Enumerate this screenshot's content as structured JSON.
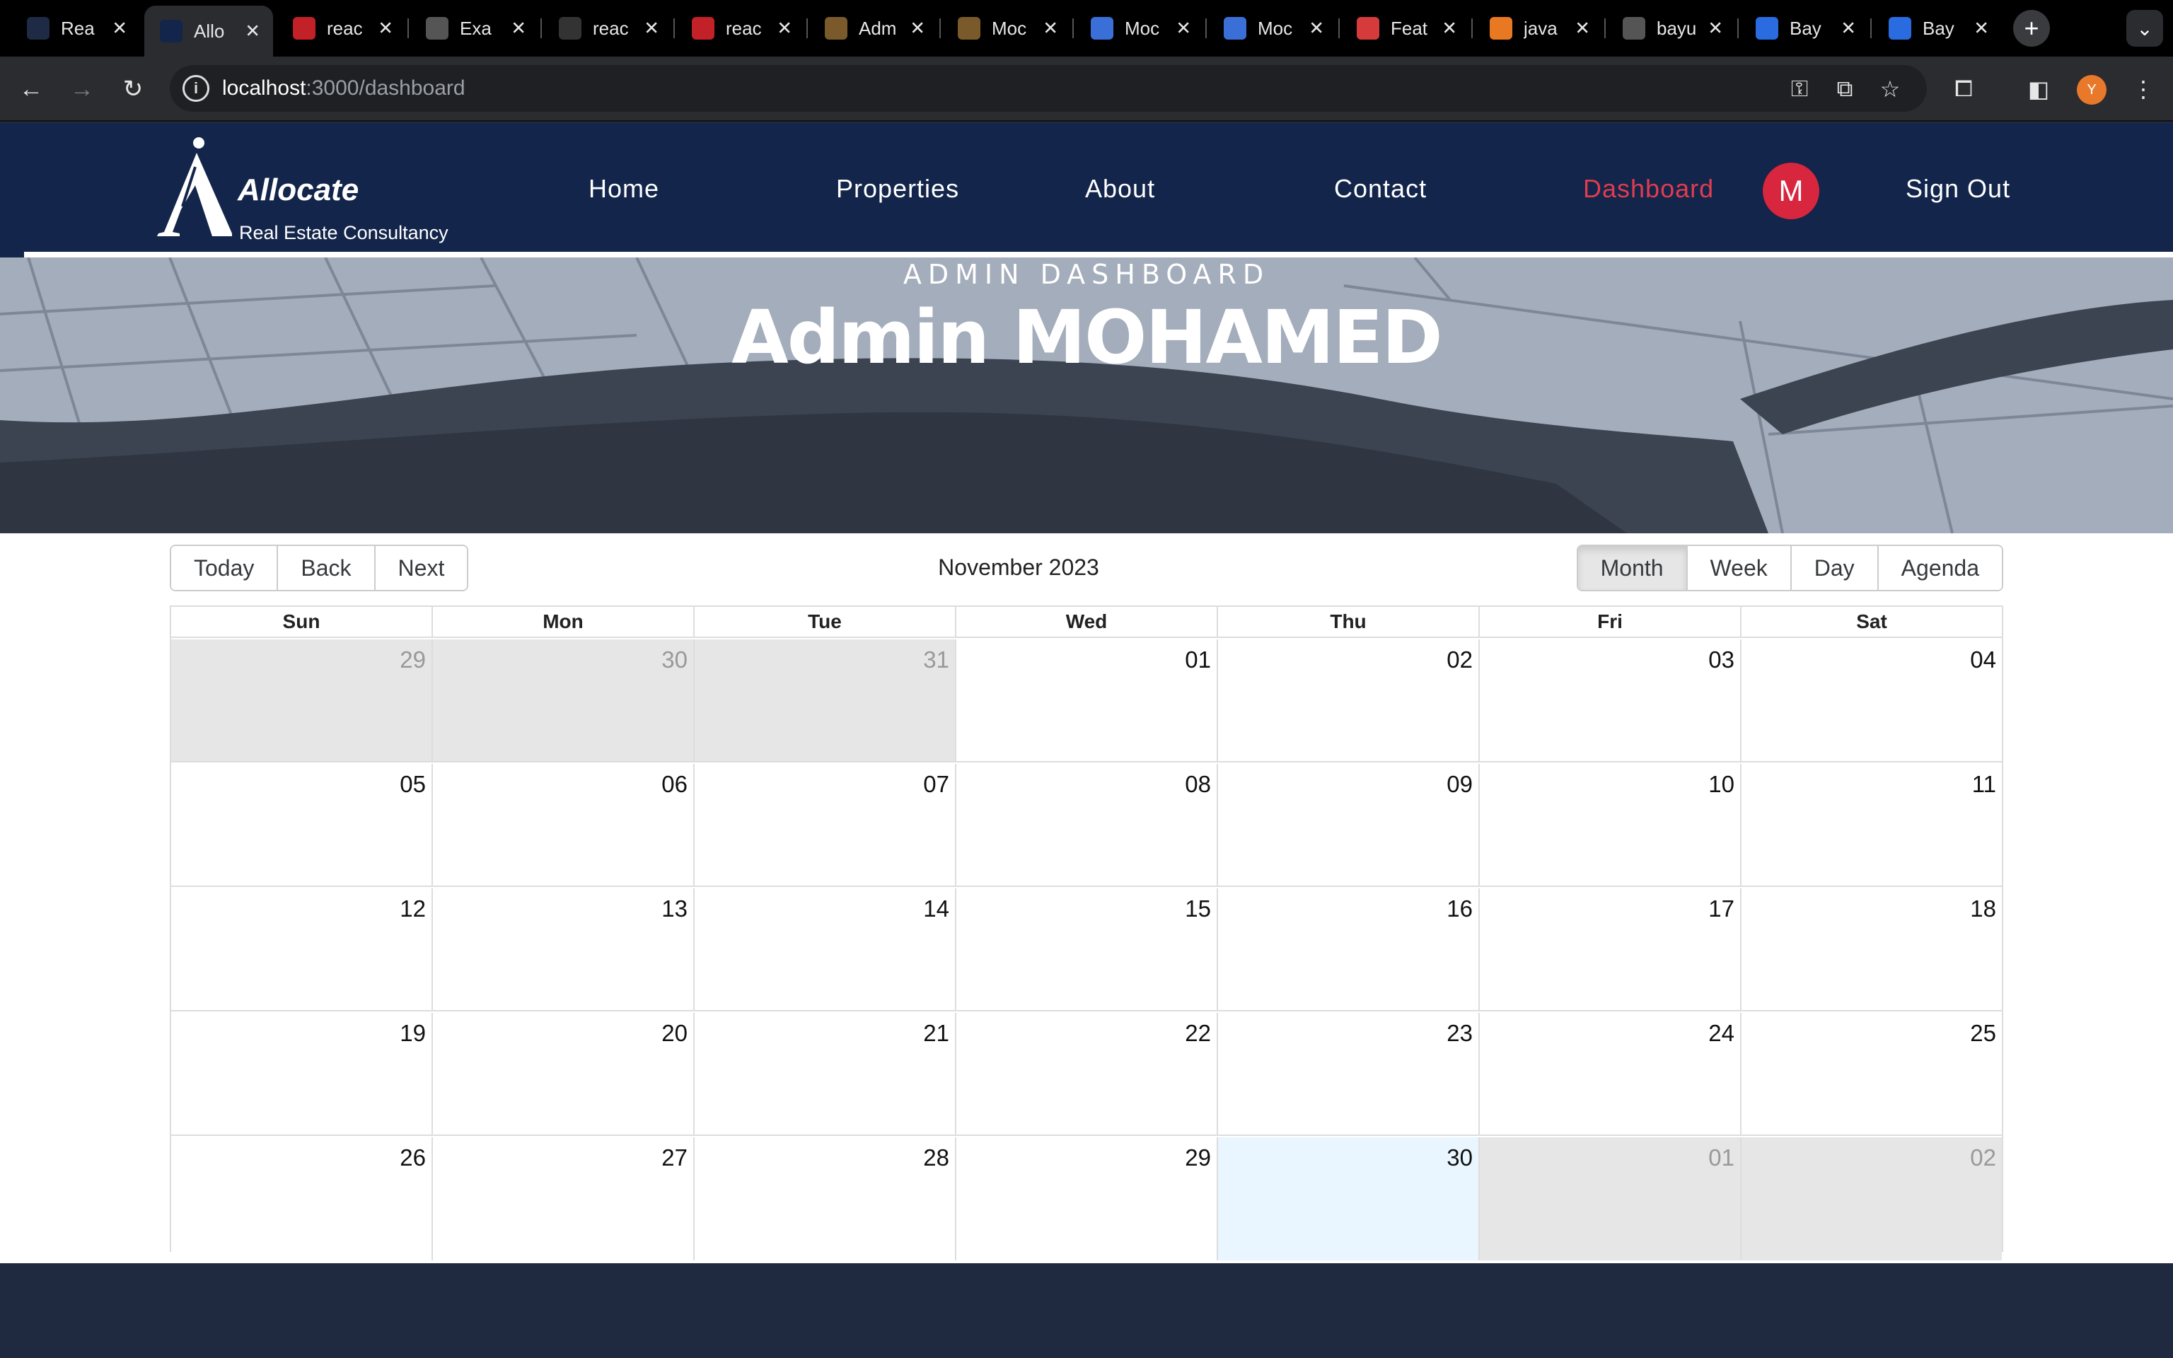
{
  "browser": {
    "tabs": [
      {
        "title": "Rea",
        "icon": "react-icon",
        "color": "#1f2a44"
      },
      {
        "title": "Allo",
        "icon": "allocate-icon",
        "color": "#13254a",
        "active": true
      },
      {
        "title": "reac",
        "icon": "npm-icon",
        "color": "#c12127"
      },
      {
        "title": "Exa",
        "icon": "globe-icon",
        "color": "#555555"
      },
      {
        "title": "reac",
        "icon": "github-icon",
        "color": "#333333"
      },
      {
        "title": "reac",
        "icon": "npm-icon",
        "color": "#c12127"
      },
      {
        "title": "Adm",
        "icon": "template-icon",
        "color": "#7a5a2a"
      },
      {
        "title": "Moc",
        "icon": "template-icon",
        "color": "#7a5a2a"
      },
      {
        "title": "Moc",
        "icon": "mui-icon",
        "color": "#3b6fd8"
      },
      {
        "title": "Moc",
        "icon": "mui-icon",
        "color": "#3b6fd8"
      },
      {
        "title": "Feat",
        "icon": "feature-icon",
        "color": "#d63b3b"
      },
      {
        "title": "java",
        "icon": "stackoverflow-icon",
        "color": "#e87922"
      },
      {
        "title": "bayu",
        "icon": "globe-icon",
        "color": "#555555"
      },
      {
        "title": "Bay",
        "icon": "search-q-icon",
        "color": "#2a6be0"
      },
      {
        "title": "Bay",
        "icon": "search-q-icon",
        "color": "#2a6be0"
      }
    ],
    "url_host": "localhost",
    "url_path": ":3000/dashboard",
    "profile_initial": "Y"
  },
  "nav": {
    "brand": "Allocate",
    "tagline": "Real Estate Consultancy",
    "links": [
      "Home",
      "Properties",
      "About",
      "Contact",
      "Dashboard"
    ],
    "active_link": "Dashboard",
    "avatar_initial": "M",
    "sign_out": "Sign Out",
    "active_color": "#e03c50",
    "background": "#13254a"
  },
  "hero": {
    "kicker": "ADMIN DASHBOARD",
    "title": "Admin MOHAMED"
  },
  "calendar": {
    "nav_buttons": [
      "Today",
      "Back",
      "Next"
    ],
    "label": "November 2023",
    "views": [
      "Month",
      "Week",
      "Day",
      "Agenda"
    ],
    "active_view": "Month",
    "weekdays": [
      "Sun",
      "Mon",
      "Tue",
      "Wed",
      "Thu",
      "Fri",
      "Sat"
    ],
    "weeks": [
      [
        {
          "d": "29",
          "off": true
        },
        {
          "d": "30",
          "off": true
        },
        {
          "d": "31",
          "off": true
        },
        {
          "d": "01"
        },
        {
          "d": "02"
        },
        {
          "d": "03"
        },
        {
          "d": "04"
        }
      ],
      [
        {
          "d": "05"
        },
        {
          "d": "06"
        },
        {
          "d": "07"
        },
        {
          "d": "08"
        },
        {
          "d": "09"
        },
        {
          "d": "10"
        },
        {
          "d": "11"
        }
      ],
      [
        {
          "d": "12"
        },
        {
          "d": "13"
        },
        {
          "d": "14"
        },
        {
          "d": "15"
        },
        {
          "d": "16"
        },
        {
          "d": "17"
        },
        {
          "d": "18"
        }
      ],
      [
        {
          "d": "19"
        },
        {
          "d": "20"
        },
        {
          "d": "21"
        },
        {
          "d": "22"
        },
        {
          "d": "23"
        },
        {
          "d": "24"
        },
        {
          "d": "25"
        }
      ],
      [
        {
          "d": "26"
        },
        {
          "d": "27"
        },
        {
          "d": "28"
        },
        {
          "d": "29"
        },
        {
          "d": "30",
          "today": true
        },
        {
          "d": "01",
          "off": true
        },
        {
          "d": "02",
          "off": true
        }
      ]
    ]
  }
}
